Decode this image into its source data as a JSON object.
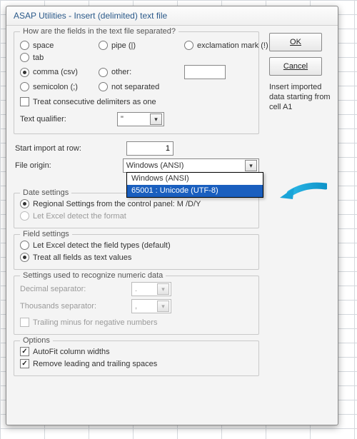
{
  "title": "ASAP Utilities - Insert (delimited) text file",
  "buttons": {
    "ok": "OK",
    "cancel": "Cancel"
  },
  "sidenote": "Insert imported data starting from cell A1",
  "separators": {
    "legend": "How are the fields in the text file separated?",
    "space": "space",
    "tab": "tab",
    "comma": "comma (csv)",
    "semicolon": "semicolon (;)",
    "pipe": "pipe (|)",
    "exclaim": "exclamation mark (!)",
    "other": "other:",
    "other_value": "",
    "notsep": "not separated",
    "consecutive": "Treat consecutive delimiters as one",
    "qualifier_label": "Text qualifier:",
    "qualifier_value": "\""
  },
  "import": {
    "startrow_label": "Start import at row:",
    "startrow_value": "1",
    "origin_label": "File origin:",
    "origin_value": "Windows (ANSI)",
    "origin_options": {
      "o0": "Windows (ANSI)",
      "o1": "65001 : Unicode (UTF-8)"
    }
  },
  "date": {
    "legend": "Date settings",
    "regional": "Regional Settings from the control panel: M /D/Y",
    "excel": "Let Excel detect the format"
  },
  "field": {
    "legend": "Field settings",
    "detect": "Let Excel detect the field types (default)",
    "text": "Treat all fields as text values"
  },
  "numeric": {
    "legend": "Settings used to recognize numeric data",
    "decimal_label": "Decimal separator:",
    "decimal_value": ".",
    "thousands_label": "Thousands separator:",
    "thousands_value": ",",
    "trailing": "Trailing minus for negative numbers"
  },
  "options": {
    "legend": "Options",
    "autofit": "AutoFit column widths",
    "trim": "Remove leading and trailing spaces"
  }
}
